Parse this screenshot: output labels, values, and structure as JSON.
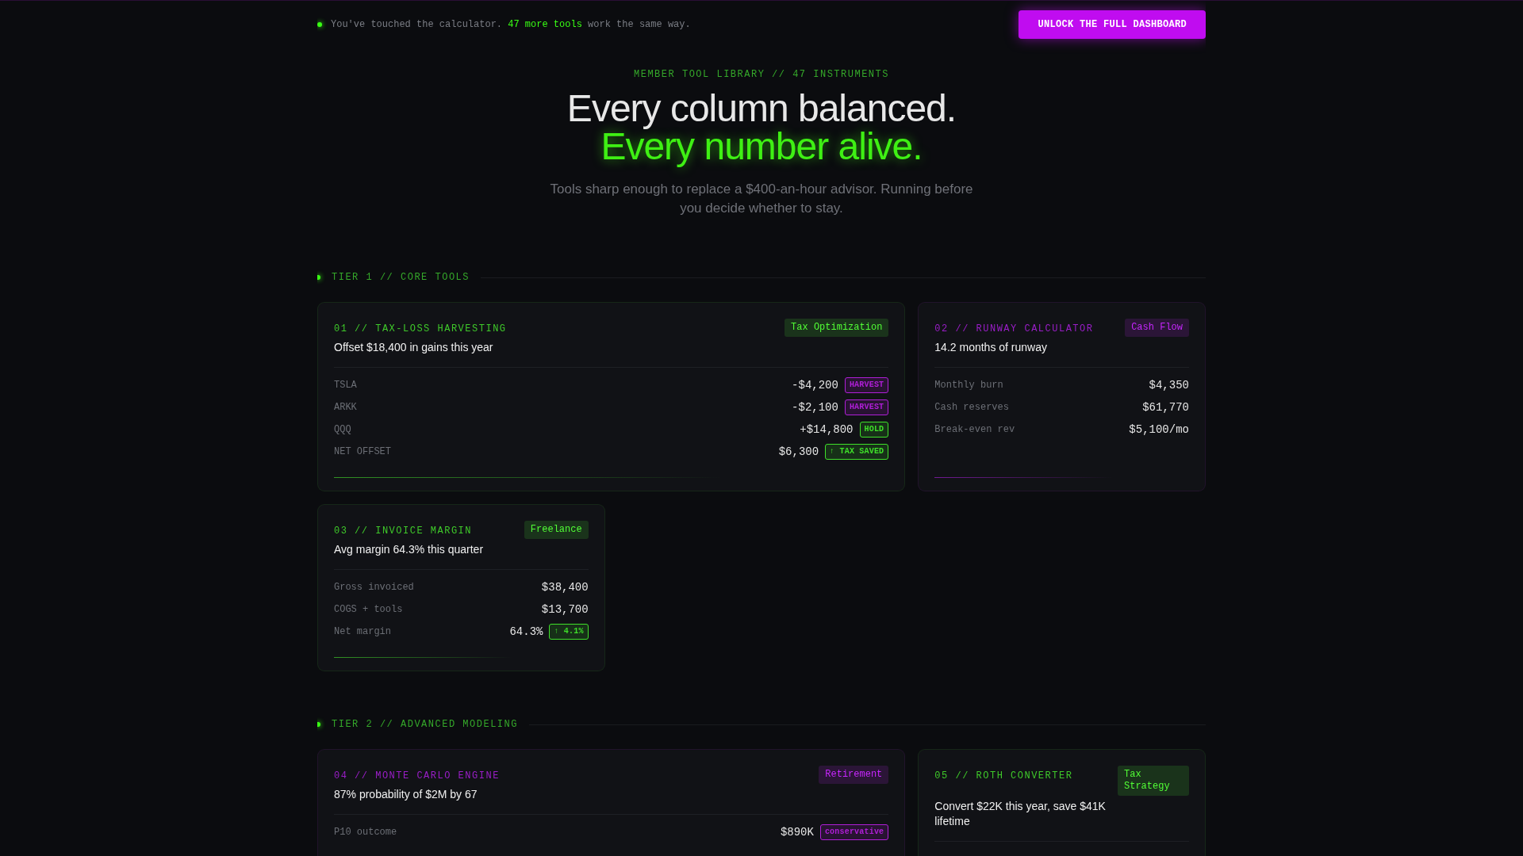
{
  "top_bar": {
    "notice": "You've touched the calculator. **47 more tools** work the same way.",
    "button": "UNLOCK THE FULL DASHBOARD"
  },
  "hero": {
    "eyebrow": "MEMBER TOOL LIBRARY // 47 INSTRUMENTS",
    "headline": "Every column balanced.",
    "headline_accent": "Every number alive.",
    "subtitle": "Tools sharp enough to replace a $400-an-hour advisor. Running before you decide whether to stay."
  },
  "tiers": [
    {
      "title": "TIER 1 // CORE TOOLS",
      "cards": [
        {
          "title": "01 // TAX-LOSS HARVESTING",
          "color": "#3fc92a",
          "wide": true,
          "tag": "Tax Optimization",
          "subtitle": "Offset $18,400 in gains this year",
          "rows": [
            {
              "label": "TSLA",
              "value": "-$4,200",
              "badge": "HARVEST",
              "color": "#b01ed8"
            },
            {
              "label": "ARKK",
              "value": "-$2,100",
              "badge": "HARVEST",
              "color": "#b01ed8"
            },
            {
              "label": "QQQ",
              "value": "+$14,800",
              "badge": "HOLD",
              "color": "#3fe02a"
            },
            {
              "label": "NET OFFSET",
              "value": "$6,300",
              "badge": "↑ TAX SAVED",
              "color": "#3fe02a"
            }
          ]
        },
        {
          "title": "02 // RUNWAY CALCULATOR",
          "color": "#9a1ec8",
          "wide": false,
          "tag": "Cash Flow",
          "subtitle": "14.2 months of runway",
          "rows": [
            {
              "label": "Monthly burn",
              "value": "$4,350"
            },
            {
              "label": "Cash reserves",
              "value": "$61,770"
            },
            {
              "label": "Break-even rev",
              "value": "$5,100/mo"
            }
          ]
        },
        {
          "title": "03 // INVOICE MARGIN",
          "color": "#3fc92a",
          "wide": false,
          "tag": "Freelance",
          "subtitle": "Avg margin 64.3% this quarter",
          "rows": [
            {
              "label": "Gross invoiced",
              "value": "$38,400"
            },
            {
              "label": "COGS + tools",
              "value": "$13,700"
            },
            {
              "label": "Net margin",
              "value": "64.3%",
              "badge": "↑ 4.1%",
              "color": "#3fe02a"
            }
          ]
        }
      ]
    },
    {
      "title": "TIER 2 // ADVANCED MODELING",
      "cards": [
        {
          "title": "04 // MONTE CARLO ENGINE",
          "color": "#9a1ec8",
          "wide": true,
          "tag": "Retirement",
          "subtitle": "87% probability of $2M by 67",
          "rows": [
            {
              "label": "P10 outcome",
              "value": "$890K",
              "badge": "conservative",
              "color": "#b01ed8"
            }
          ]
        },
        {
          "title": "05 // ROTH CONVERTER",
          "color": "#3fc92a",
          "wide": false,
          "tag": "Tax Strategy",
          "subtitle": "Convert $22K this year, save $41K lifetime"
        }
      ]
    }
  ]
}
